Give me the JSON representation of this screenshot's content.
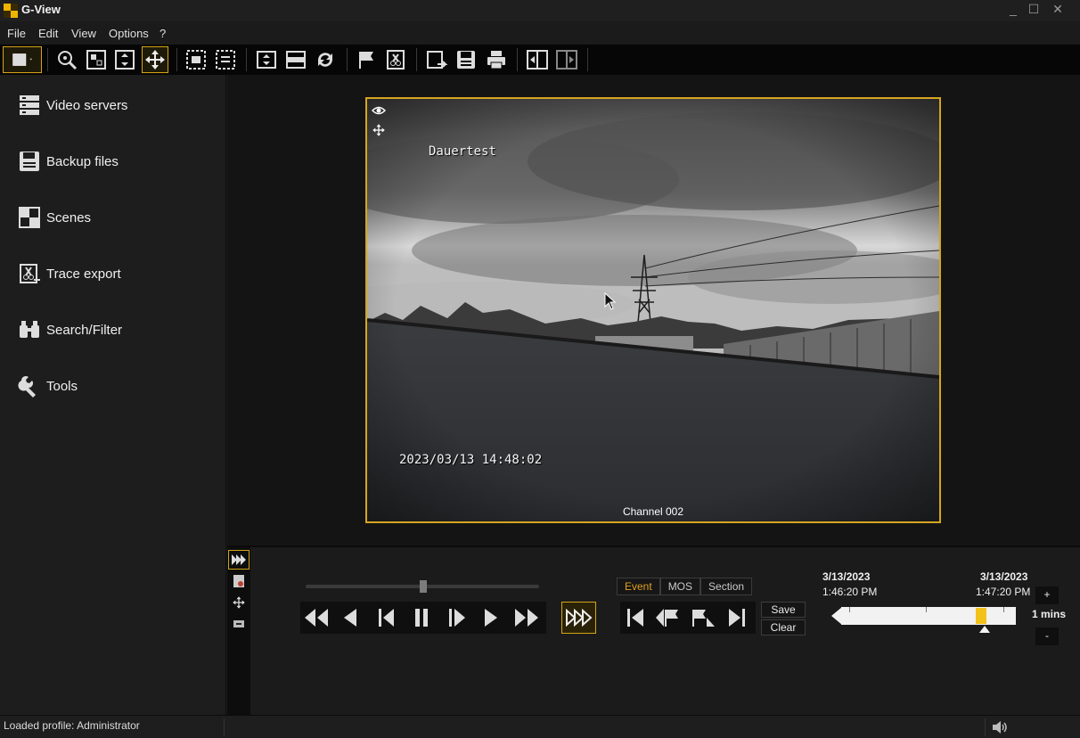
{
  "app": {
    "title": "G-View"
  },
  "window_controls": {
    "minimize": "_",
    "maximize": "☐",
    "close": "✕"
  },
  "menu": [
    "File",
    "Edit",
    "View",
    "Options",
    "?"
  ],
  "sidebar": {
    "items": [
      {
        "label": "Video servers",
        "icon": "server-stack-icon"
      },
      {
        "label": "Backup files",
        "icon": "floppy-disk-icon"
      },
      {
        "label": "Scenes",
        "icon": "scenes-grid-icon"
      },
      {
        "label": "Trace export",
        "icon": "scissors-export-icon"
      },
      {
        "label": "Search/Filter",
        "icon": "binoculars-icon"
      },
      {
        "label": "Tools",
        "icon": "wrench-icon"
      }
    ]
  },
  "video": {
    "overlay_name": "Dauertest",
    "timestamp": "2023/03/13 14:48:02",
    "channel": "Channel 002"
  },
  "controls": {
    "mode_tabs": [
      "Event",
      "MOS",
      "Section"
    ],
    "selected_mode": "Event",
    "save_label": "Save",
    "clear_label": "Clear"
  },
  "timeline": {
    "start_date": "3/13/2023",
    "start_time": "1:46:20 PM",
    "end_date": "3/13/2023",
    "end_time": "1:47:20 PM",
    "zoom_label": "1 mins",
    "zoom_in": "+",
    "zoom_out": "-",
    "position_fraction": 0.82
  },
  "status": {
    "text": "Loaded profile: Administrator"
  },
  "colors": {
    "accent": "#d4a417",
    "marker": "#f2c21a",
    "background": "#1b1b1b"
  }
}
